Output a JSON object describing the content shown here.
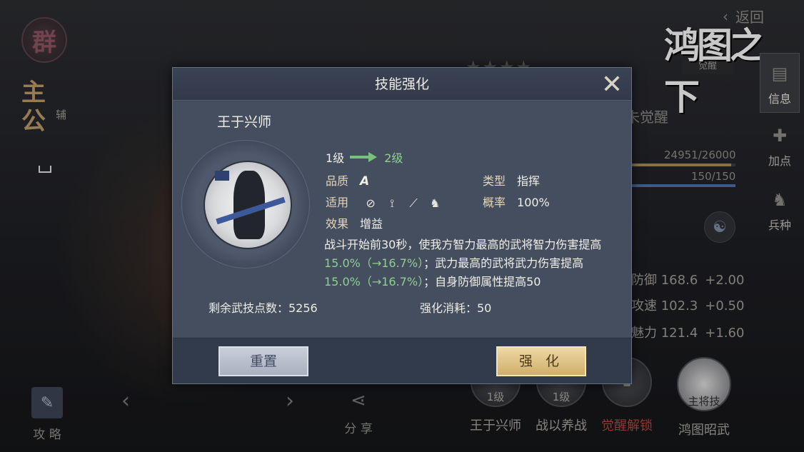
{
  "background": {
    "seal_char": "群",
    "lord_label": "主公",
    "aux_tag": "辅",
    "back_label": "返回",
    "logo_text": "鸿图之下",
    "logo_tag": "觉醒",
    "awaken_status": "未觉醒",
    "exp_text": "24951/26000",
    "troops_text": "150/150",
    "side_tabs": [
      {
        "label": "信息",
        "icon": "scroll-icon"
      },
      {
        "label": "加点",
        "icon": "plus-points-icon"
      },
      {
        "label": "兵种",
        "icon": "horse-icon"
      }
    ],
    "stats": [
      {
        "label": "防御",
        "value": "168.6",
        "inc": "+2.00"
      },
      {
        "label": "攻速",
        "value": "102.3",
        "inc": "+0.50"
      },
      {
        "label": "魅力",
        "value": "121.4",
        "inc": "+1.60"
      }
    ],
    "bottom_left": {
      "strategy": "攻 略",
      "share": "分 享"
    },
    "skills": [
      {
        "name": "王于兴师",
        "level": "1级"
      },
      {
        "name": "战以养战",
        "level": "1级"
      },
      {
        "name": "觉醒解锁",
        "level": ""
      },
      {
        "name": "鸿图昭武",
        "level": "主将技"
      }
    ]
  },
  "dialog": {
    "title": "技能强化",
    "skill_name": "王于兴师",
    "level_from": "1级",
    "level_to": "2级",
    "quality_label": "品质",
    "quality_value": "A",
    "type_label": "类型",
    "type_value": "指挥",
    "applicable_label": "适用",
    "rate_label": "概率",
    "rate_value": "100%",
    "effect_label": "效果",
    "effect_value": "增益",
    "desc": {
      "p1": "战斗开始前30秒，使我方智力最高的武将智力伤害提高",
      "g1": "15.0%（→16.7%）",
      "p2": "；武力最高的武将武力伤害提高",
      "g2": "15.0%（→16.7%）",
      "p3": "；自身防御属性提高50"
    },
    "points_text": "剩余武技点数：5256",
    "cost_text": "强化消耗：50",
    "reset_label": "重置",
    "enhance_label": "强 化"
  },
  "colors": {
    "green": "#8fd08f",
    "gold": "#cfae6c",
    "panel": "#444e5f"
  }
}
